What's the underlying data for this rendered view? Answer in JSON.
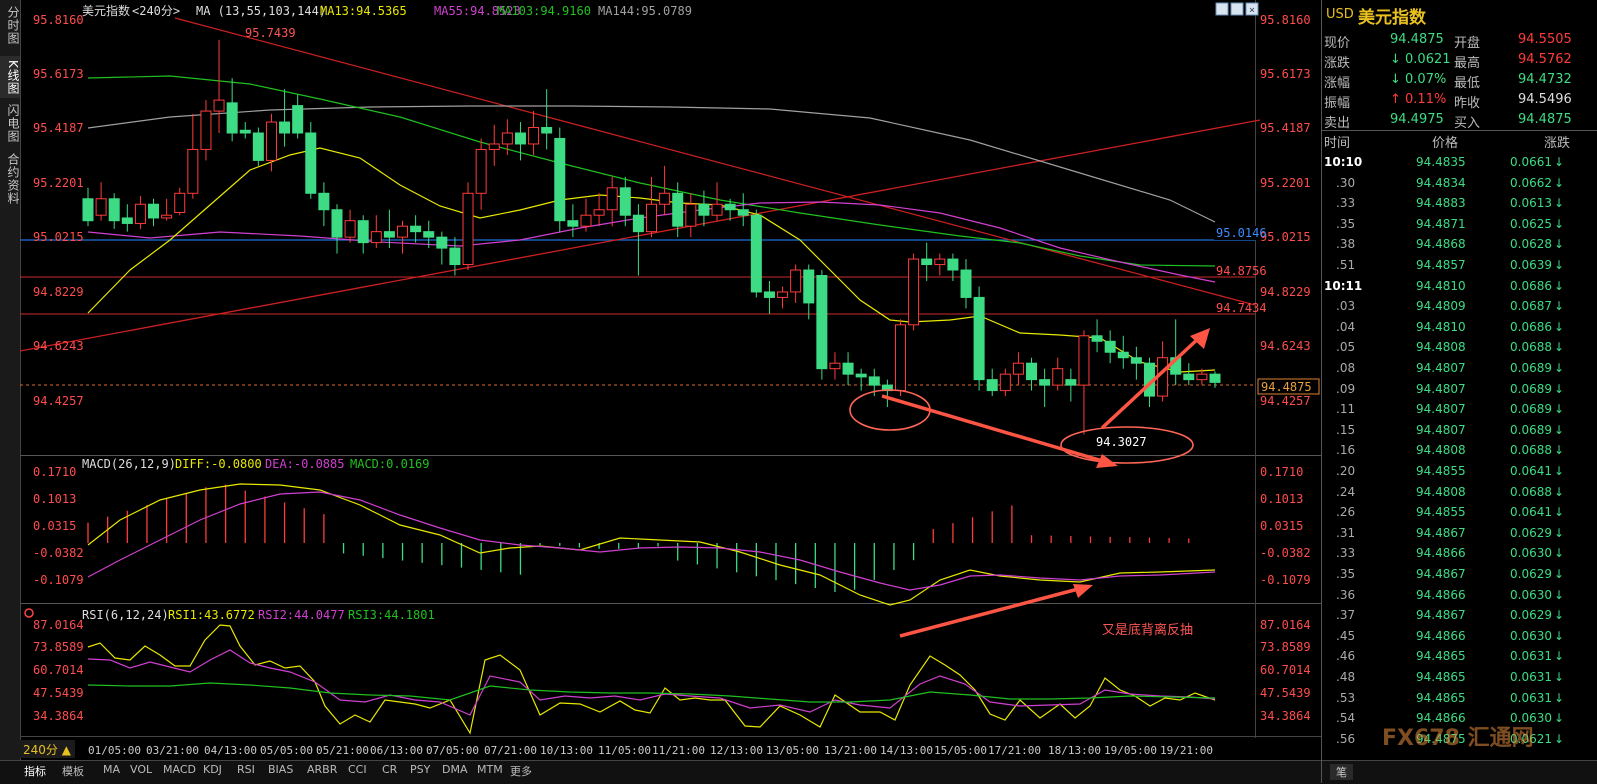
{
  "left_tabs": [
    "分时图",
    "K线图",
    "闪电图",
    "合约资料"
  ],
  "chart_header": {
    "name": "美元指数",
    "period": "<240分>",
    "ma_label": "MA (13,55,103,144)",
    "ma13": "MA13:94.5365",
    "ma55": "MA55:94.8523",
    "ma103": "MA103:94.9160",
    "ma144": "MA144:95.0789"
  },
  "price_axis": [
    "95.8160",
    "95.6173",
    "95.4187",
    "95.2201",
    "95.0215",
    "94.8229",
    "94.6243",
    "94.4257"
  ],
  "price_tags": {
    "current": "94.4875",
    "blue_line": "95.0146",
    "red_line_1": "94.8756",
    "red_line_2": "94.7434",
    "high_label": "95.7439",
    "low_label": "94.3027"
  },
  "macd_header": {
    "label": "MACD(26,12,9)",
    "diff": "DIFF:-0.0800",
    "dea": "DEA:-0.0885",
    "macd": "MACD:0.0169"
  },
  "macd_axis": [
    "0.1710",
    "0.1013",
    "0.0315",
    "-0.0382",
    "-0.1079"
  ],
  "rsi_header": {
    "label": "RSI(6,12,24)",
    "rsi1": "RSI1:43.6772",
    "rsi2": "RSI2:44.0477",
    "rsi3": "RSI3:44.1801"
  },
  "rsi_axis": [
    "87.0164",
    "73.8589",
    "60.7014",
    "47.5439",
    "34.3864"
  ],
  "annotation": "又是底背离反抽",
  "time_axis": [
    "01/05:00",
    "03/21:00",
    "04/13:00",
    "05/05:00",
    "05/21:00",
    "06/13:00",
    "07/05:00",
    "07/21:00",
    "10/13:00",
    "11/05:00",
    "11/21:00",
    "12/13:00",
    "13/05:00",
    "13/21:00",
    "14/13:00",
    "15/05:00",
    "17/21:00",
    "18/13:00",
    "19/05:00",
    "19/21:00"
  ],
  "period_button": "240分 ▲",
  "bottom_tabs": [
    "指标",
    "模板",
    "MA",
    "VOL",
    "MACD",
    "KDJ",
    "RSI",
    "BIAS",
    "ARBR",
    "CCI",
    "CR",
    "PSY",
    "DMA",
    "MTM",
    "更多"
  ],
  "quote": {
    "symbol": "USD",
    "name": "美元指数",
    "rows": [
      {
        "l1": "现价",
        "v1": "94.4875",
        "l2": "开盘",
        "v2": "94.5505"
      },
      {
        "l1": "涨跌",
        "v1": "↓ 0.0621",
        "l2": "最高",
        "v2": "94.5762"
      },
      {
        "l1": "涨幅",
        "v1": "↓ 0.07%",
        "l2": "最低",
        "v2": "94.4732"
      },
      {
        "l1": "振幅",
        "v1": "↑ 0.11%",
        "l2": "昨收",
        "v2": "94.5496"
      },
      {
        "l1": "卖出",
        "v1": "94.4975",
        "l2": "买入",
        "v2": "94.4875"
      }
    ]
  },
  "ticks_header": {
    "time": "时间",
    "price": "价格",
    "change": "涨跌"
  },
  "ticks": [
    {
      "t": "10:10",
      "p": "94.4835",
      "c": "0.0661"
    },
    {
      "t": ".30",
      "p": "94.4834",
      "c": "0.0662"
    },
    {
      "t": ".33",
      "p": "94.4883",
      "c": "0.0613"
    },
    {
      "t": ".35",
      "p": "94.4871",
      "c": "0.0625"
    },
    {
      "t": ".38",
      "p": "94.4868",
      "c": "0.0628"
    },
    {
      "t": ".51",
      "p": "94.4857",
      "c": "0.0639"
    },
    {
      "t": "10:11",
      "p": "94.4810",
      "c": "0.0686"
    },
    {
      "t": ".03",
      "p": "94.4809",
      "c": "0.0687"
    },
    {
      "t": ".04",
      "p": "94.4810",
      "c": "0.0686"
    },
    {
      "t": ".05",
      "p": "94.4808",
      "c": "0.0688"
    },
    {
      "t": ".08",
      "p": "94.4807",
      "c": "0.0689"
    },
    {
      "t": ".09",
      "p": "94.4807",
      "c": "0.0689"
    },
    {
      "t": ".11",
      "p": "94.4807",
      "c": "0.0689"
    },
    {
      "t": ".15",
      "p": "94.4807",
      "c": "0.0689"
    },
    {
      "t": ".16",
      "p": "94.4808",
      "c": "0.0688"
    },
    {
      "t": ".20",
      "p": "94.4855",
      "c": "0.0641"
    },
    {
      "t": ".24",
      "p": "94.4808",
      "c": "0.0688"
    },
    {
      "t": ".26",
      "p": "94.4855",
      "c": "0.0641"
    },
    {
      "t": ".31",
      "p": "94.4867",
      "c": "0.0629"
    },
    {
      "t": ".33",
      "p": "94.4866",
      "c": "0.0630"
    },
    {
      "t": ".35",
      "p": "94.4867",
      "c": "0.0629"
    },
    {
      "t": ".36",
      "p": "94.4866",
      "c": "0.0630"
    },
    {
      "t": ".37",
      "p": "94.4867",
      "c": "0.0629"
    },
    {
      "t": ".45",
      "p": "94.4866",
      "c": "0.0630"
    },
    {
      "t": ".46",
      "p": "94.4865",
      "c": "0.0631"
    },
    {
      "t": ".48",
      "p": "94.4865",
      "c": "0.0631"
    },
    {
      "t": ".53",
      "p": "94.4865",
      "c": "0.0631"
    },
    {
      "t": ".54",
      "p": "94.4866",
      "c": "0.0630"
    },
    {
      "t": ".56",
      "p": "94.4875",
      "c": "0.0621"
    }
  ],
  "ticks_footer": "笔",
  "watermark": "FX678 汇通网",
  "colors": {
    "up": "#ff3b3b",
    "down": "#3ddc84",
    "ma13": "#e8e800",
    "ma55": "#d040d0",
    "ma103": "#20c020",
    "ma144": "#a0a0a0",
    "blue_line": "#1e6fd9"
  },
  "candles": [
    [
      95.16,
      95.08,
      95.2,
      95.06
    ],
    [
      95.1,
      95.16,
      95.22,
      95.08
    ],
    [
      95.16,
      95.08,
      95.18,
      95.05
    ],
    [
      95.09,
      95.07,
      95.14,
      95.04
    ],
    [
      95.07,
      95.14,
      95.17,
      95.05
    ],
    [
      95.14,
      95.09,
      95.16,
      95.06
    ],
    [
      95.09,
      95.1,
      95.16,
      95.08
    ],
    [
      95.11,
      95.18,
      95.2,
      95.1
    ],
    [
      95.18,
      95.34,
      95.47,
      95.16
    ],
    [
      95.34,
      95.48,
      95.52,
      95.3
    ],
    [
      95.48,
      95.52,
      95.74,
      95.4
    ],
    [
      95.51,
      95.4,
      95.6,
      95.37
    ],
    [
      95.41,
      95.4,
      95.44,
      95.38
    ],
    [
      95.4,
      95.3,
      95.42,
      95.28
    ],
    [
      95.3,
      95.44,
      95.47,
      95.26
    ],
    [
      95.44,
      95.4,
      95.56,
      95.35
    ],
    [
      95.5,
      95.4,
      95.54,
      95.38
    ],
    [
      95.4,
      95.18,
      95.44,
      95.16
    ],
    [
      95.18,
      95.12,
      95.22,
      95.06
    ],
    [
      95.12,
      95.02,
      95.14,
      94.96
    ],
    [
      95.02,
      95.08,
      95.12,
      95.0
    ],
    [
      95.08,
      95.0,
      95.1,
      94.96
    ],
    [
      95.0,
      95.04,
      95.1,
      94.98
    ],
    [
      95.04,
      95.02,
      95.12,
      94.98
    ],
    [
      95.02,
      95.06,
      95.08,
      94.96
    ],
    [
      95.06,
      95.04,
      95.1,
      95.0
    ],
    [
      95.04,
      95.02,
      95.08,
      94.98
    ],
    [
      95.02,
      94.98,
      95.04,
      94.92
    ],
    [
      94.98,
      94.92,
      95.02,
      94.88
    ],
    [
      94.92,
      95.18,
      95.22,
      94.9
    ],
    [
      95.18,
      95.34,
      95.38,
      95.12
    ],
    [
      95.34,
      95.36,
      95.43,
      95.28
    ],
    [
      95.36,
      95.4,
      95.45,
      95.32
    ],
    [
      95.4,
      95.36,
      95.44,
      95.3
    ],
    [
      95.36,
      95.42,
      95.48,
      95.32
    ],
    [
      95.42,
      95.4,
      95.56,
      95.34
    ],
    [
      95.38,
      95.08,
      95.42,
      95.04
    ],
    [
      95.08,
      95.06,
      95.14,
      95.02
    ],
    [
      95.06,
      95.1,
      95.16,
      95.04
    ],
    [
      95.1,
      95.12,
      95.18,
      95.06
    ],
    [
      95.12,
      95.2,
      95.24,
      95.06
    ],
    [
      95.2,
      95.1,
      95.24,
      95.06
    ],
    [
      95.1,
      95.04,
      95.14,
      94.88
    ],
    [
      95.04,
      95.14,
      95.24,
      95.02
    ],
    [
      95.14,
      95.18,
      95.28,
      95.1
    ],
    [
      95.18,
      95.06,
      95.22,
      95.02
    ],
    [
      95.06,
      95.14,
      95.18,
      95.02
    ],
    [
      95.14,
      95.1,
      95.19,
      95.06
    ],
    [
      95.1,
      95.14,
      95.22,
      95.08
    ],
    [
      95.14,
      95.12,
      95.16,
      95.08
    ],
    [
      95.12,
      95.1,
      95.18,
      95.06
    ],
    [
      95.1,
      94.82,
      95.12,
      94.8
    ],
    [
      94.82,
      94.8,
      94.86,
      94.74
    ],
    [
      94.8,
      94.82,
      94.84,
      94.76
    ],
    [
      94.82,
      94.9,
      94.92,
      94.78
    ],
    [
      94.9,
      94.78,
      94.92,
      94.72
    ],
    [
      94.88,
      94.54,
      94.9,
      94.5
    ],
    [
      94.54,
      94.56,
      94.6,
      94.5
    ],
    [
      94.56,
      94.52,
      94.6,
      94.48
    ],
    [
      94.52,
      94.51,
      94.54,
      94.46
    ],
    [
      94.51,
      94.48,
      94.54,
      94.44
    ],
    [
      94.48,
      94.46,
      94.5,
      94.4
    ],
    [
      94.46,
      94.7,
      94.72,
      94.44
    ],
    [
      94.7,
      94.94,
      94.96,
      94.68
    ],
    [
      94.94,
      94.92,
      95.0,
      94.86
    ],
    [
      94.92,
      94.94,
      94.96,
      94.88
    ],
    [
      94.94,
      94.9,
      94.96,
      94.86
    ],
    [
      94.9,
      94.8,
      94.94,
      94.76
    ],
    [
      94.8,
      94.5,
      94.84,
      94.46
    ],
    [
      94.5,
      94.46,
      94.54,
      94.44
    ],
    [
      94.46,
      94.52,
      94.54,
      94.44
    ],
    [
      94.52,
      94.56,
      94.6,
      94.48
    ],
    [
      94.56,
      94.5,
      94.58,
      94.46
    ],
    [
      94.5,
      94.48,
      94.54,
      94.4
    ],
    [
      94.48,
      94.54,
      94.58,
      94.46
    ],
    [
      94.5,
      94.48,
      94.54,
      94.42
    ],
    [
      94.48,
      94.66,
      94.68,
      94.3
    ],
    [
      94.66,
      94.64,
      94.72,
      94.6
    ],
    [
      94.64,
      94.6,
      94.68,
      94.56
    ],
    [
      94.6,
      94.58,
      94.66,
      94.54
    ],
    [
      94.58,
      94.56,
      94.62,
      94.5
    ],
    [
      94.56,
      94.44,
      94.58,
      94.4
    ],
    [
      94.44,
      94.58,
      94.64,
      94.42
    ],
    [
      94.58,
      94.52,
      94.72,
      94.48
    ],
    [
      94.52,
      94.5,
      94.56,
      94.48
    ],
    [
      94.5,
      94.52,
      94.54,
      94.48
    ],
    [
      94.52,
      94.49,
      94.53,
      94.47
    ]
  ]
}
